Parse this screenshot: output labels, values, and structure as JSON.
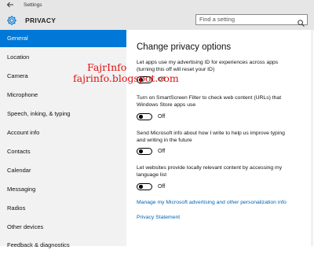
{
  "window": {
    "title": "Settings"
  },
  "header": {
    "title": "PRIVACY"
  },
  "search": {
    "placeholder": "Find a setting"
  },
  "sidebar": {
    "items": [
      {
        "label": "General",
        "selected": true
      },
      {
        "label": "Location"
      },
      {
        "label": "Camera"
      },
      {
        "label": "Microphone"
      },
      {
        "label": "Speech, inking, & typing"
      },
      {
        "label": "Account info"
      },
      {
        "label": "Contacts"
      },
      {
        "label": "Calendar"
      },
      {
        "label": "Messaging"
      },
      {
        "label": "Radios"
      },
      {
        "label": "Other devices"
      },
      {
        "label": "Feedback & diagnostics"
      }
    ]
  },
  "main": {
    "title": "Change privacy options",
    "settings": [
      {
        "line1": "Let apps use my advertising ID for experiences across apps",
        "line2": "(turning this off will reset your ID)",
        "state": "Off"
      },
      {
        "line1": "Turn on SmartScreen Filter to check web content (URLs) that",
        "line2": "Windows Store apps use",
        "state": "Off"
      },
      {
        "line1": "Send Microsoft info about how I write to help us improve typing",
        "line2": "and writing in the future",
        "state": "Off"
      },
      {
        "line1": "Let websites provide locally relevant content by accessing my",
        "line2": "language list",
        "state": "Off"
      }
    ],
    "links": {
      "manage_advertising": "Manage my Microsoft advertising and other personalization info",
      "privacy_statement": "Privacy Statement"
    }
  },
  "watermark": {
    "line1": "FajrInfo",
    "line2": "fajrinfo.blogspot.com"
  },
  "colors": {
    "accent": "#0078d7",
    "link": "#0063b1",
    "watermark": "#e01010"
  }
}
